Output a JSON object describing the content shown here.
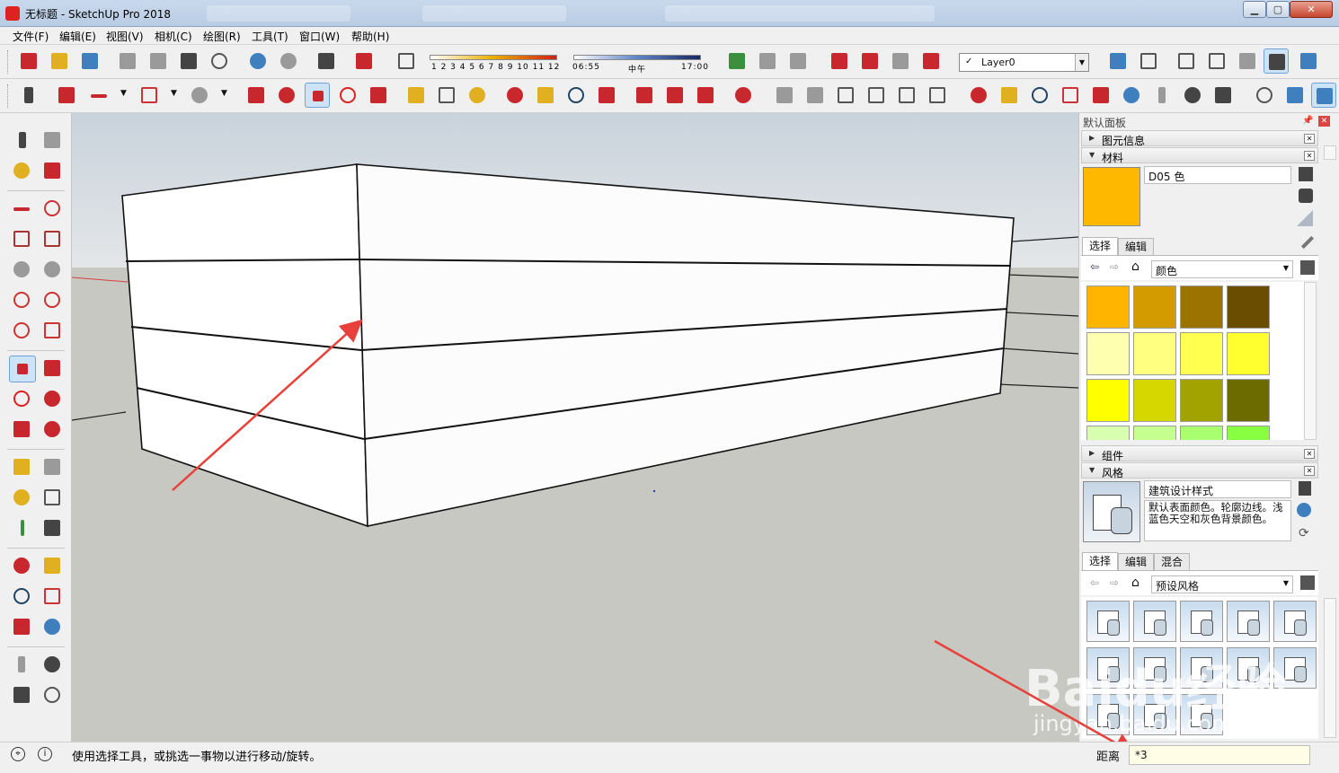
{
  "window": {
    "title": "无标题 - SketchUp Pro 2018"
  },
  "menu": [
    "文件(F)",
    "编辑(E)",
    "视图(V)",
    "相机(C)",
    "绘图(R)",
    "工具(T)",
    "窗口(W)",
    "帮助(H)"
  ],
  "shadow": {
    "month_ticks": "1 2 3 4 5 6 7 8 9 10 11 12",
    "time_start": "06:55",
    "time_mid": "中午",
    "time_end": "17:00"
  },
  "layer": {
    "check": "✓",
    "name": "Layer0"
  },
  "tray": {
    "title": "默认面板",
    "entity_info": "图元信息",
    "materials": "材料",
    "material_name": "D05 色",
    "material_color": "#FFB800",
    "mat_tab_select": "选择",
    "mat_tab_edit": "编辑",
    "mat_library": "颜色",
    "swatches": [
      "#FFB400",
      "#D39B00",
      "#9C7200",
      "#6A4D00",
      "#FFFFB0",
      "#FFFF80",
      "#FFFF50",
      "#FFFF30",
      "#FFFF00",
      "#D6D600",
      "#A3A300",
      "#6B6B00"
    ],
    "components": "组件",
    "styles": "风格",
    "style_name": "建筑设计样式",
    "style_desc": "默认表面颜色。轮廓边线。浅蓝色天空和灰色背景颜色。",
    "style_tab_select": "选择",
    "style_tab_edit": "编辑",
    "style_tab_mix": "混合",
    "style_library": "预设风格"
  },
  "status": {
    "hint": "使用选择工具，或挑选一事物以进行移动/旋转。",
    "vcb_label": "距离",
    "vcb_value": "*3"
  },
  "watermark": {
    "brand": "Baidu经验",
    "url": "jingyan.baidu.com"
  },
  "colors": {
    "sky": "#d9dee3",
    "ground": "#c8c8c2",
    "accent_arrow": "#e8403a"
  }
}
